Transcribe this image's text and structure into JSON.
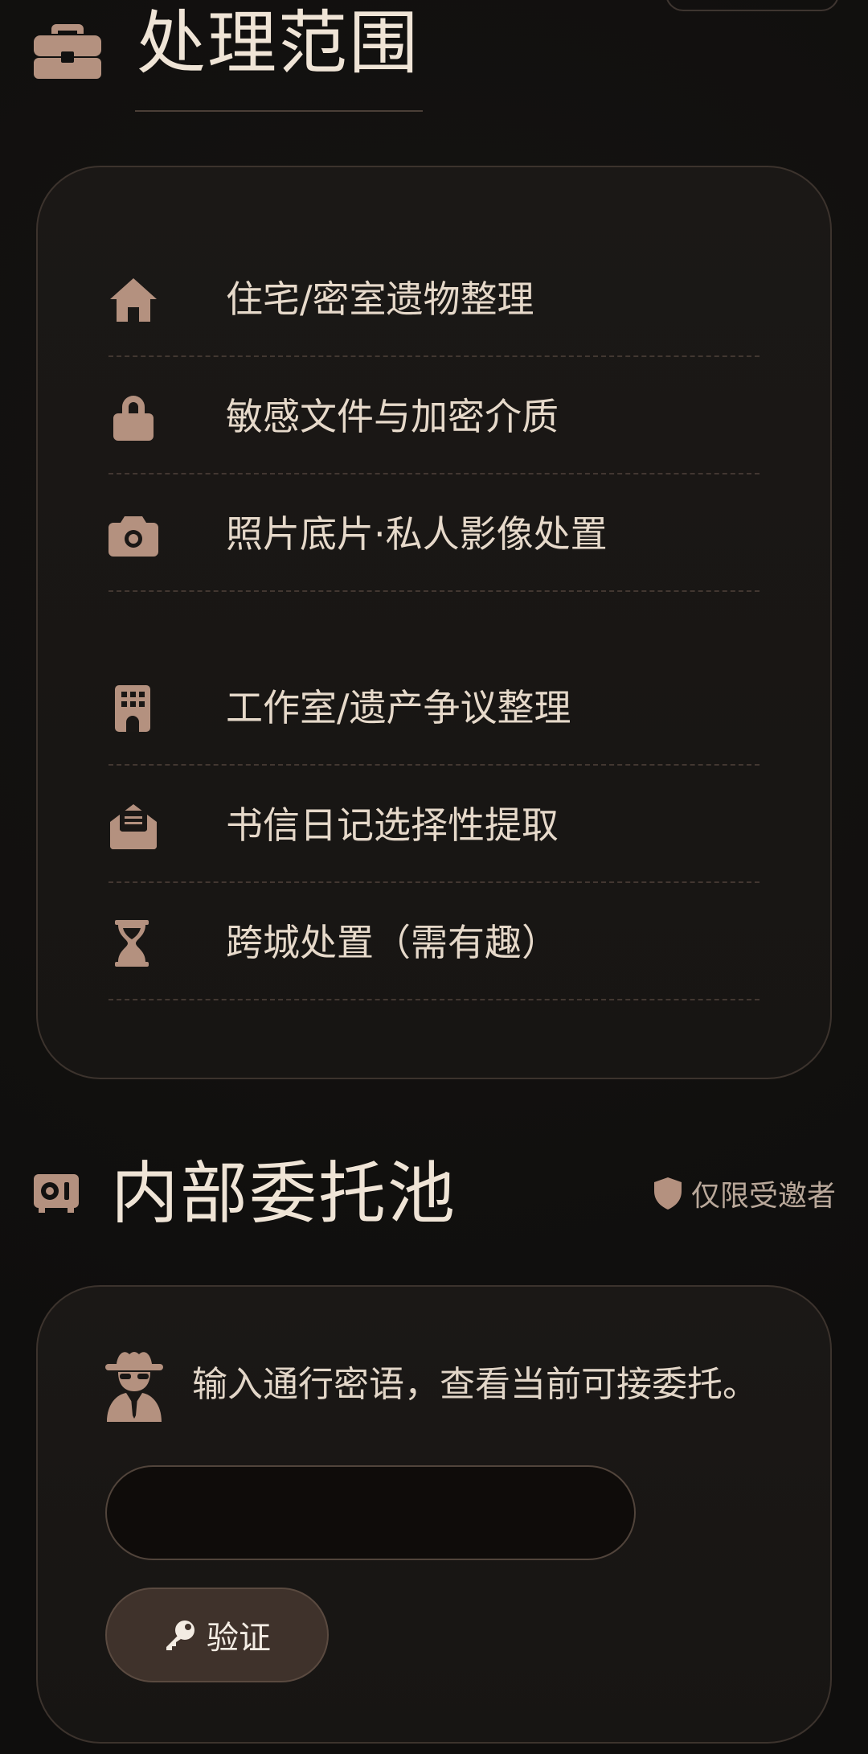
{
  "colors": {
    "background": "#121110",
    "card": "#1a1715",
    "card_border": "#3c332d",
    "icon": "#b4917f",
    "text": "#e6d9ca",
    "muted": "#b9a89a",
    "button_bg": "#3f322b"
  },
  "scope_section": {
    "title": "处理范围",
    "icon": "briefcase-icon",
    "items": [
      {
        "icon": "home-icon",
        "label": "住宅/密室遗物整理"
      },
      {
        "icon": "lock-icon",
        "label": "敏感文件与加密介质"
      },
      {
        "icon": "camera-icon",
        "label": "照片底片·私人影像处置"
      },
      {
        "icon": "building-icon",
        "label": "工作室/遗产争议整理"
      },
      {
        "icon": "envelope-open-icon",
        "label": "书信日记选择性提取"
      },
      {
        "icon": "hourglass-icon",
        "label": "跨城处置（需有趣）"
      }
    ]
  },
  "pool_section": {
    "title": "内部委托池",
    "icon": "vault-icon",
    "badge": {
      "icon": "shield-icon",
      "label": "仅限受邀者"
    },
    "hint_icon": "spy-icon",
    "hint": "输入通行密语，查看当前可接委托。",
    "input": {
      "value": "",
      "placeholder": ""
    },
    "verify_button": {
      "icon": "key-icon",
      "label": "验证"
    }
  }
}
